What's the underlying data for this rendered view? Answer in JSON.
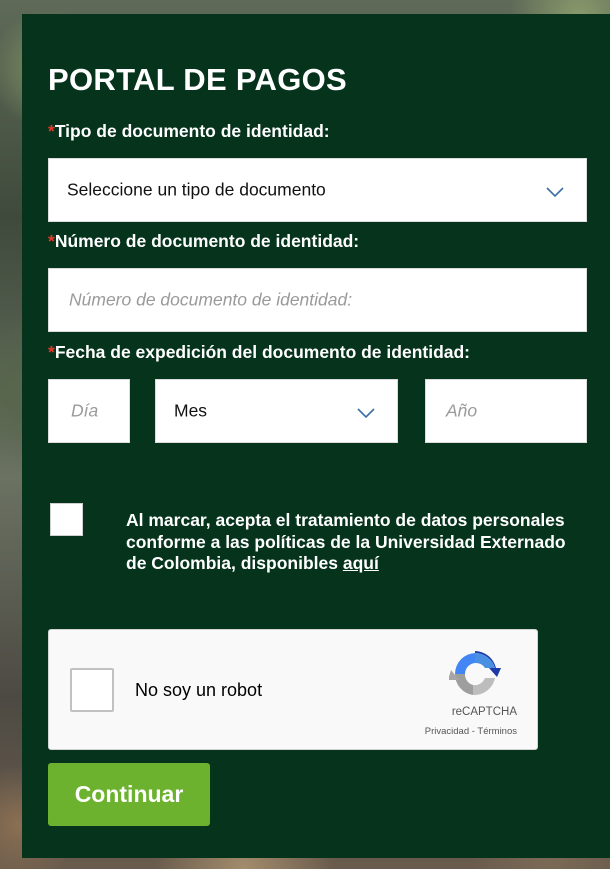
{
  "form": {
    "title": "PORTAL DE PAGOS",
    "required_mark": "*",
    "document_type": {
      "label": "Tipo de documento de identidad:",
      "selected": "Seleccione un tipo de documento"
    },
    "document_number": {
      "label": "Número de documento de identidad:",
      "placeholder": "Número de documento de identidad:"
    },
    "expedition_date": {
      "label": "Fecha de expedición del documento de identidad:",
      "day_placeholder": "Día",
      "month_selected": "Mes",
      "year_placeholder": "Año"
    },
    "consent": {
      "text": "Al marcar, acepta el tratamiento de datos personales conforme a las políticas de la Universidad Externado de Colombia, disponibles",
      "link_text": "aquí"
    },
    "recaptcha": {
      "label": "No soy un robot",
      "brand": "reCAPTCHA",
      "privacy": "Privacidad",
      "separator": " - ",
      "terms": "Términos"
    },
    "submit_label": "Continuar"
  },
  "colors": {
    "panel": "#06331c",
    "required": "#e23a2b",
    "button": "#6cb22f",
    "chevron": "#3b6ea5"
  },
  "icons": [
    "chevron-down-icon",
    "recaptcha-logo-icon",
    "checkbox-icon"
  ]
}
